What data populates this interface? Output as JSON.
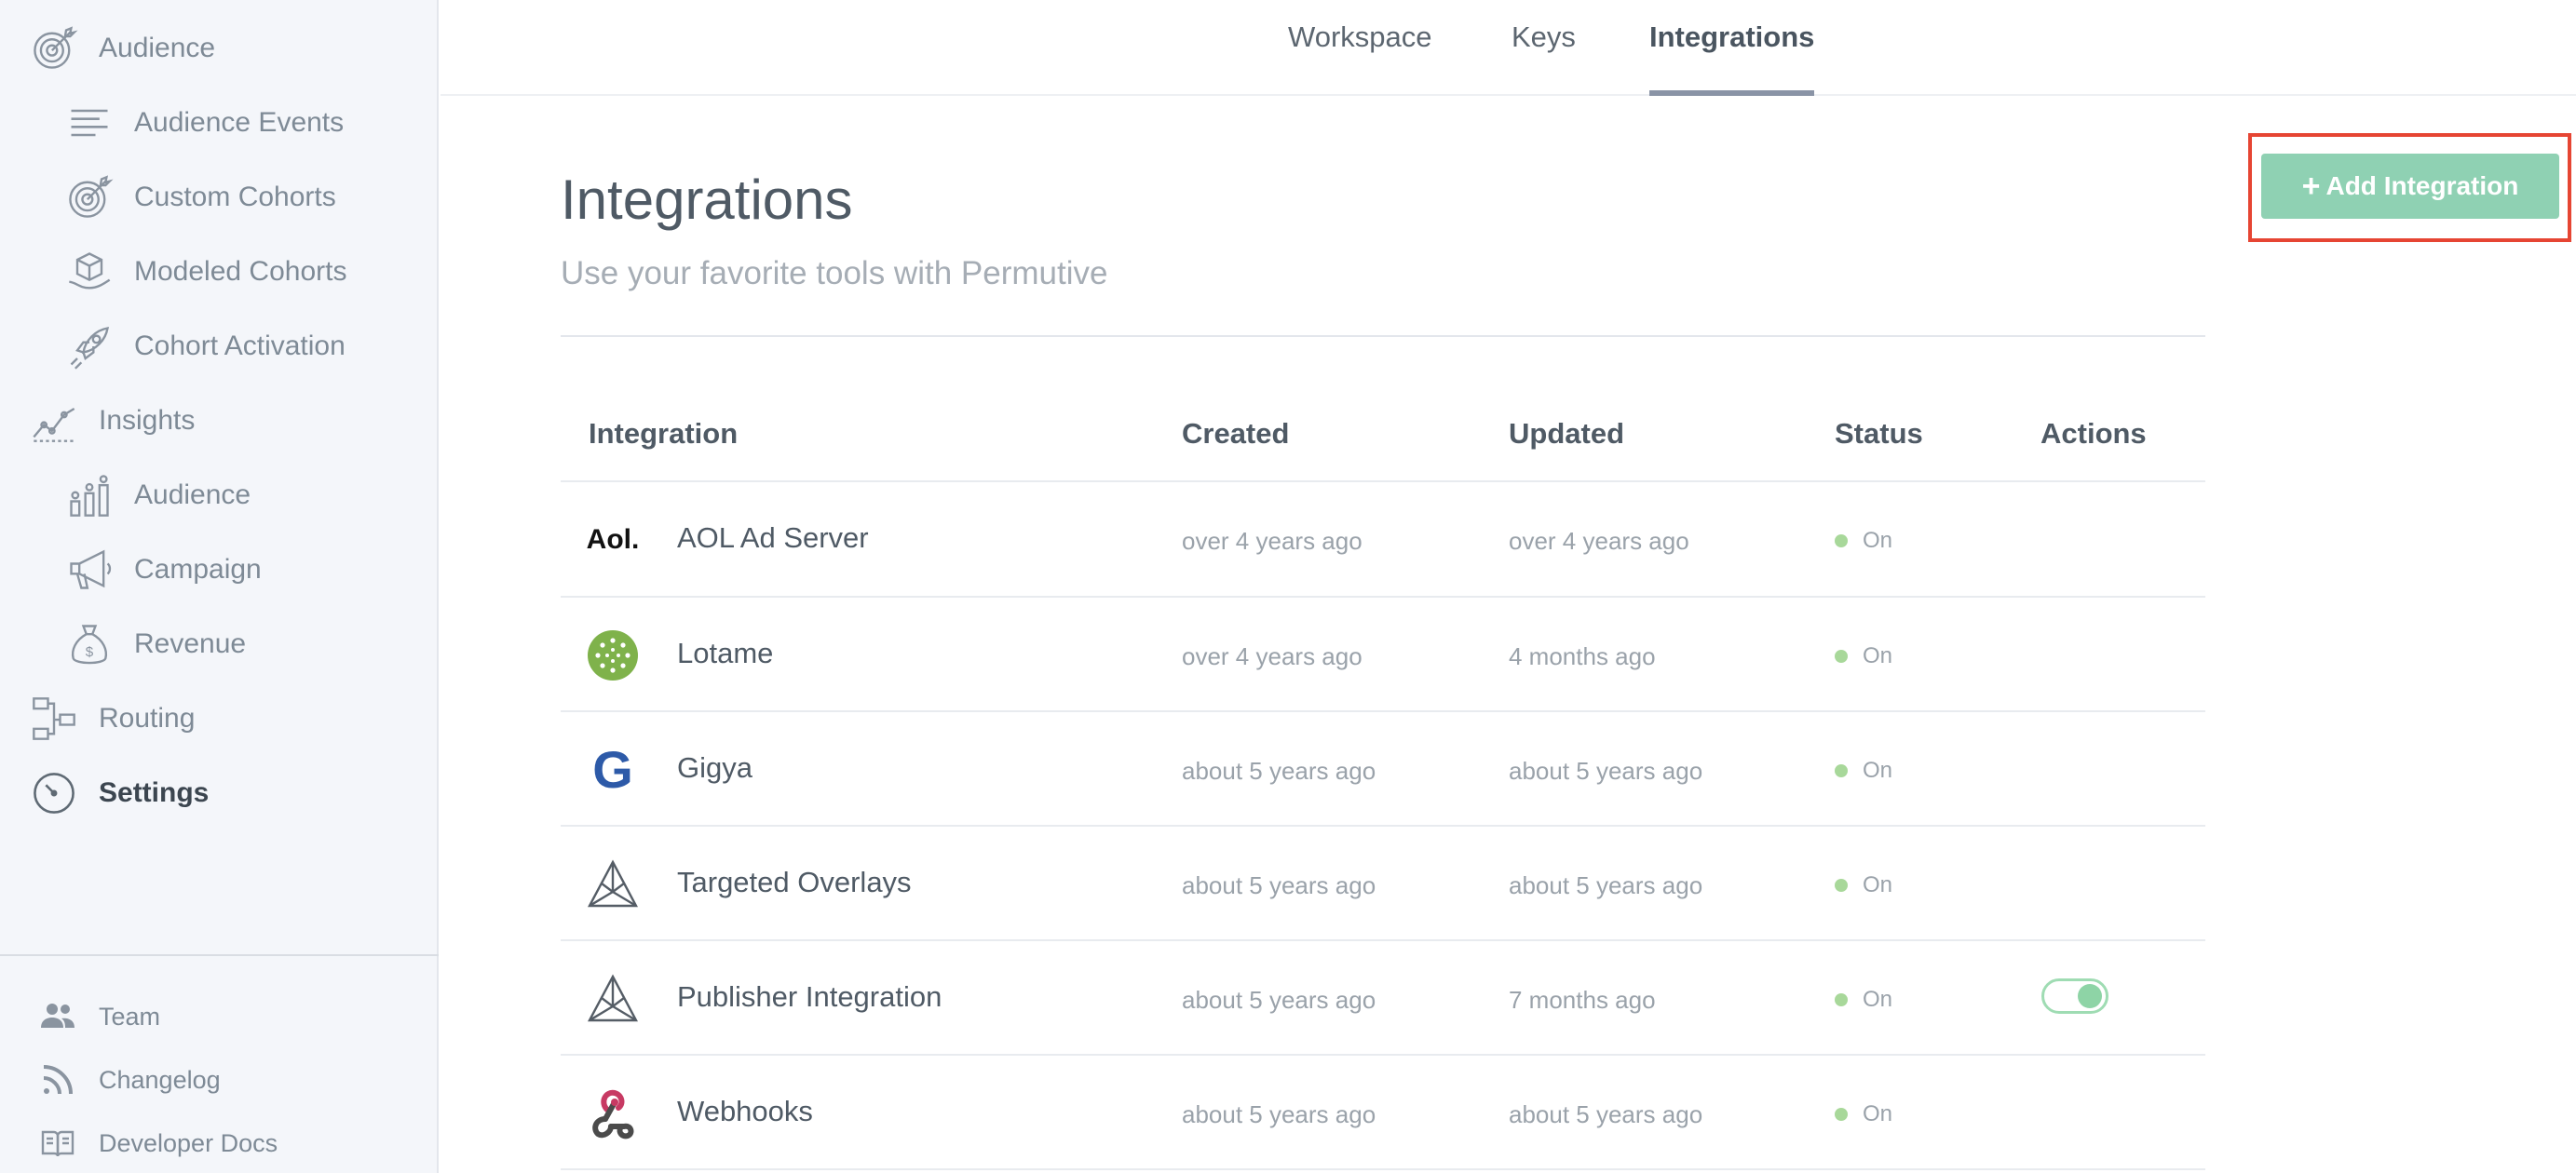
{
  "colors": {
    "sidebar_bg": "#f4f6fa",
    "accent_green": "#8fd1b3",
    "status_on": "#a8d89a",
    "highlight_red": "#e64533"
  },
  "sidebar": {
    "items": [
      {
        "label": "Audience",
        "icon": "target-icon",
        "level": "top"
      },
      {
        "label": "Audience Events",
        "icon": "lines-icon",
        "level": "sub"
      },
      {
        "label": "Custom Cohorts",
        "icon": "target-icon",
        "level": "sub"
      },
      {
        "label": "Modeled Cohorts",
        "icon": "cube-hand-icon",
        "level": "sub"
      },
      {
        "label": "Cohort Activation",
        "icon": "rocket-icon",
        "level": "sub"
      },
      {
        "label": "Insights",
        "icon": "trend-icon",
        "level": "top"
      },
      {
        "label": "Audience",
        "icon": "bar-people-icon",
        "level": "sub"
      },
      {
        "label": "Campaign",
        "icon": "megaphone-icon",
        "level": "sub"
      },
      {
        "label": "Revenue",
        "icon": "money-bag-icon",
        "level": "sub"
      },
      {
        "label": "Routing",
        "icon": "routing-icon",
        "level": "top"
      },
      {
        "label": "Settings",
        "icon": "gauge-icon",
        "level": "top",
        "active": true
      }
    ],
    "footer": [
      {
        "label": "Team",
        "icon": "team-icon"
      },
      {
        "label": "Changelog",
        "icon": "rss-icon"
      },
      {
        "label": "Developer Docs",
        "icon": "book-icon"
      }
    ]
  },
  "tabs": [
    {
      "label": "Workspace"
    },
    {
      "label": "Keys"
    },
    {
      "label": "Integrations",
      "active": true
    }
  ],
  "header": {
    "title": "Integrations",
    "subtitle": "Use your favorite tools with Permutive",
    "add_button_label": "Add Integration",
    "add_button_icon": "plus-icon"
  },
  "table": {
    "columns": [
      "Integration",
      "Created",
      "Updated",
      "Status",
      "Actions"
    ],
    "rows": [
      {
        "name": "AOL Ad Server",
        "logo": "aol-logo",
        "logo_text": "Aol.",
        "created": "over 4 years ago",
        "updated": "over 4 years ago",
        "status": "On"
      },
      {
        "name": "Lotame",
        "logo": "lotame-logo",
        "created": "over 4 years ago",
        "updated": "4 months ago",
        "status": "On"
      },
      {
        "name": "Gigya",
        "logo": "gigya-logo",
        "logo_text": "G",
        "created": "about 5 years ago",
        "updated": "about 5 years ago",
        "status": "On"
      },
      {
        "name": "Targeted Overlays",
        "logo": "permutive-logo",
        "created": "about 5 years ago",
        "updated": "about 5 years ago",
        "status": "On"
      },
      {
        "name": "Publisher Integration",
        "logo": "permutive-logo",
        "created": "about 5 years ago",
        "updated": "7 months ago",
        "status": "On",
        "action_toggle": true
      },
      {
        "name": "Webhooks",
        "logo": "webhooks-logo",
        "created": "about 5 years ago",
        "updated": "about 5 years ago",
        "status": "On"
      }
    ]
  }
}
